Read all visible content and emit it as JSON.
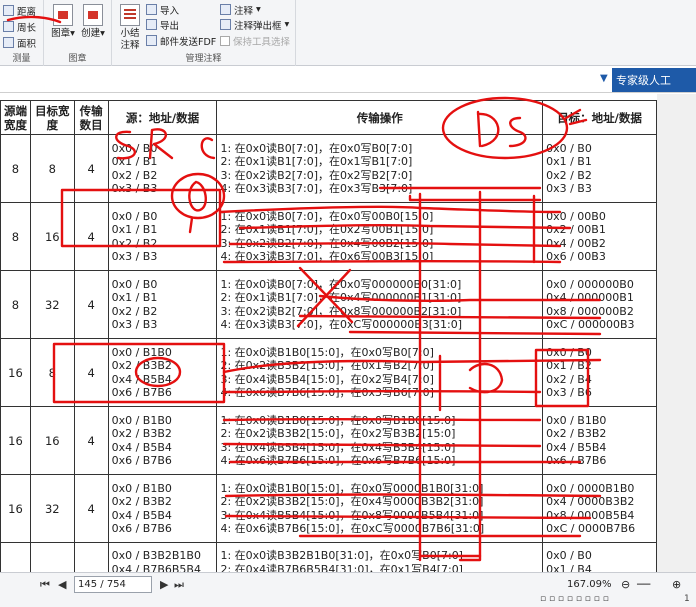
{
  "ribbon": {
    "group_measure": {
      "label": "测量",
      "items": [
        "距离",
        "周长",
        "面积"
      ]
    },
    "group_stamp": {
      "label": "图章",
      "items": [
        "图章",
        "创建"
      ]
    },
    "group_manage": {
      "label": "管理注释",
      "summary": "小结注释",
      "items": [
        "导入",
        "导出",
        "邮件发送FDF"
      ],
      "annot": "注释",
      "popup": "注释弹出框",
      "keep_tool": "保持工具选择"
    }
  },
  "header": {
    "dropdown_label": "专家级人工"
  },
  "table": {
    "headers": [
      "源端宽度",
      "目标宽度",
      "传输数目",
      "源：地址/数据",
      "传输操作",
      "目标：地址/数据"
    ],
    "rows": [
      {
        "src_w": "8",
        "dst_w": "8",
        "count": "4",
        "src": [
          "0x0 / B0",
          "0x1 / B1",
          "0x2 / B2",
          "0x3 / B3"
        ],
        "ops": [
          "1: 在0x0读B0[7:0]，在0x0写B0[7:0]",
          "2: 在0x1读B1[7:0]，在0x1写B1[7:0]",
          "3: 在0x2读B2[7:0]，在0x2写B2[7:0]",
          "4: 在0x3读B3[7:0]，在0x3写B3[7:0]"
        ],
        "dst": [
          "0x0 / B0",
          "0x1 / B1",
          "0x2 / B2",
          "0x3 / B3"
        ]
      },
      {
        "src_w": "8",
        "dst_w": "16",
        "count": "4",
        "src": [
          "0x0 / B0",
          "0x1 / B1",
          "0x2 / B2",
          "0x3 / B3"
        ],
        "ops": [
          "1: 在0x0读B0[7:0]，在0x0写00B0[15:0]",
          "2: 在0x1读B1[7:0]，在0x2写00B1[15:0]",
          "3: 在0x2读B2[7:0]，在0x4写00B2[15:0]",
          "4: 在0x3读B3[7:0]，在0x6写00B3[15:0]"
        ],
        "dst": [
          "0x0 / 00B0",
          "0x2 / 00B1",
          "0x4 / 00B2",
          "0x6 / 00B3"
        ]
      },
      {
        "src_w": "8",
        "dst_w": "32",
        "count": "4",
        "src": [
          "0x0 / B0",
          "0x1 / B1",
          "0x2 / B2",
          "0x3 / B3"
        ],
        "ops": [
          "1: 在0x0读B0[7:0]，在0x0写000000B0[31:0]",
          "2: 在0x1读B1[7:0]，在0x4写000000B1[31:0]",
          "3: 在0x2读B2[7:0]，在0x8写000000B2[31:0]",
          "4: 在0x3读B3[7:0]，在0xC写000000B3[31:0]"
        ],
        "dst": [
          "0x0 / 000000B0",
          "0x4 / 000000B1",
          "0x8 / 000000B2",
          "0xC / 000000B3"
        ]
      },
      {
        "src_w": "16",
        "dst_w": "8",
        "count": "4",
        "src": [
          "0x0 / B1B0",
          "0x2 / B3B2",
          "0x4 / B5B4",
          "0x6 / B7B6"
        ],
        "ops": [
          "1: 在0x0读B1B0[15:0]，在0x0写B0[7:0]",
          "2: 在0x2读B3B2[15:0]，在0x1写B2[7:0]",
          "3: 在0x4读B5B4[15:0]，在0x2写B4[7:0]",
          "4: 在0x6读B7B6[15:0]，在0x3写B6[7:0]"
        ],
        "dst": [
          "0x0 / B0",
          "0x1 / B2",
          "0x2 / B4",
          "0x3 / B6"
        ]
      },
      {
        "src_w": "16",
        "dst_w": "16",
        "count": "4",
        "src": [
          "0x0 / B1B0",
          "0x2 / B3B2",
          "0x4 / B5B4",
          "0x6 / B7B6"
        ],
        "ops": [
          "1: 在0x0读B1B0[15:0]，在0x0写B1B0[15:0]",
          "2: 在0x2读B3B2[15:0]，在0x2写B3B2[15:0]",
          "3: 在0x4读B5B4[15:0]，在0x4写B5B4[15:0]",
          "4: 在0x6读B7B6[15:0]，在0x6写B7B6[15:0]"
        ],
        "dst": [
          "0x0 / B1B0",
          "0x2 / B3B2",
          "0x4 / B5B4",
          "0x6 / B7B6"
        ]
      },
      {
        "src_w": "16",
        "dst_w": "32",
        "count": "4",
        "src": [
          "0x0 / B1B0",
          "0x2 / B3B2",
          "0x4 / B5B4",
          "0x6 / B7B6"
        ],
        "ops": [
          "1: 在0x0读B1B0[15:0]，在0x0写0000B1B0[31:0]",
          "2: 在0x2读B3B2[15:0]，在0x4写0000B3B2[31:0]",
          "3: 在0x4读B5B4[15:0]，在0x8写0000B5B4[31:0]",
          "4: 在0x6读B7B6[15:0]，在0xC写0000B7B6[31:0]"
        ],
        "dst": [
          "0x0 / 0000B1B0",
          "0x4 / 0000B3B2",
          "0x8 / 0000B5B4",
          "0xC / 0000B7B6"
        ]
      },
      {
        "src_w": "",
        "dst_w": "",
        "count": "",
        "src": [
          "0x0 / B3B2B1B0",
          "0x4 / B7B6B5B4"
        ],
        "ops": [
          "1: 在0x0读B3B2B1B0[31:0]，在0x0写B0[7:0]",
          "2: 在0x4读B7B6B5B4[31:0]，在0x1写B4[7:0]"
        ],
        "dst": [
          "0x0 / B0",
          "0x1 / B4"
        ]
      }
    ]
  },
  "annotations": {
    "sr": "SR",
    "ds": "DS"
  },
  "bottombar": {
    "page_indicator": "145 / 754",
    "zoom": "167.09%",
    "tray_time": "1"
  },
  "colors": {
    "ink": "#e41010",
    "dropdown_bg": "#1e5aa8"
  }
}
